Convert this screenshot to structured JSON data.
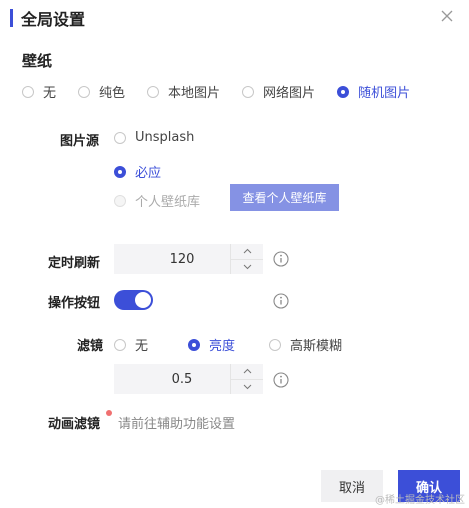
{
  "dialog": {
    "title": "全局设置"
  },
  "wallpaper": {
    "section_title": "壁纸",
    "options": [
      "无",
      "纯色",
      "本地图片",
      "网络图片",
      "随机图片"
    ],
    "selected_index": 4
  },
  "image_source": {
    "label": "图片源",
    "options": [
      "Unsplash",
      "必应",
      "个人壁纸库"
    ],
    "selected_index": 1,
    "disabled_index": 2,
    "view_button": "查看个人壁纸库"
  },
  "refresh": {
    "label": "定时刷新",
    "value": "120"
  },
  "action_buttons": {
    "label": "操作按钮",
    "enabled": true
  },
  "filter": {
    "label": "滤镜",
    "options": [
      "无",
      "亮度",
      "高斯模糊"
    ],
    "selected_index": 1,
    "value": "0.5"
  },
  "anim_filter": {
    "label": "动画滤镜",
    "hint": "请前往辅助功能设置"
  },
  "footer": {
    "cancel": "取消",
    "ok": "确认"
  },
  "watermark": "@稀土掘金技术社区",
  "colors": {
    "accent": "#3c4fd8",
    "accent_light": "#8592e4",
    "badge": "#f07070"
  }
}
